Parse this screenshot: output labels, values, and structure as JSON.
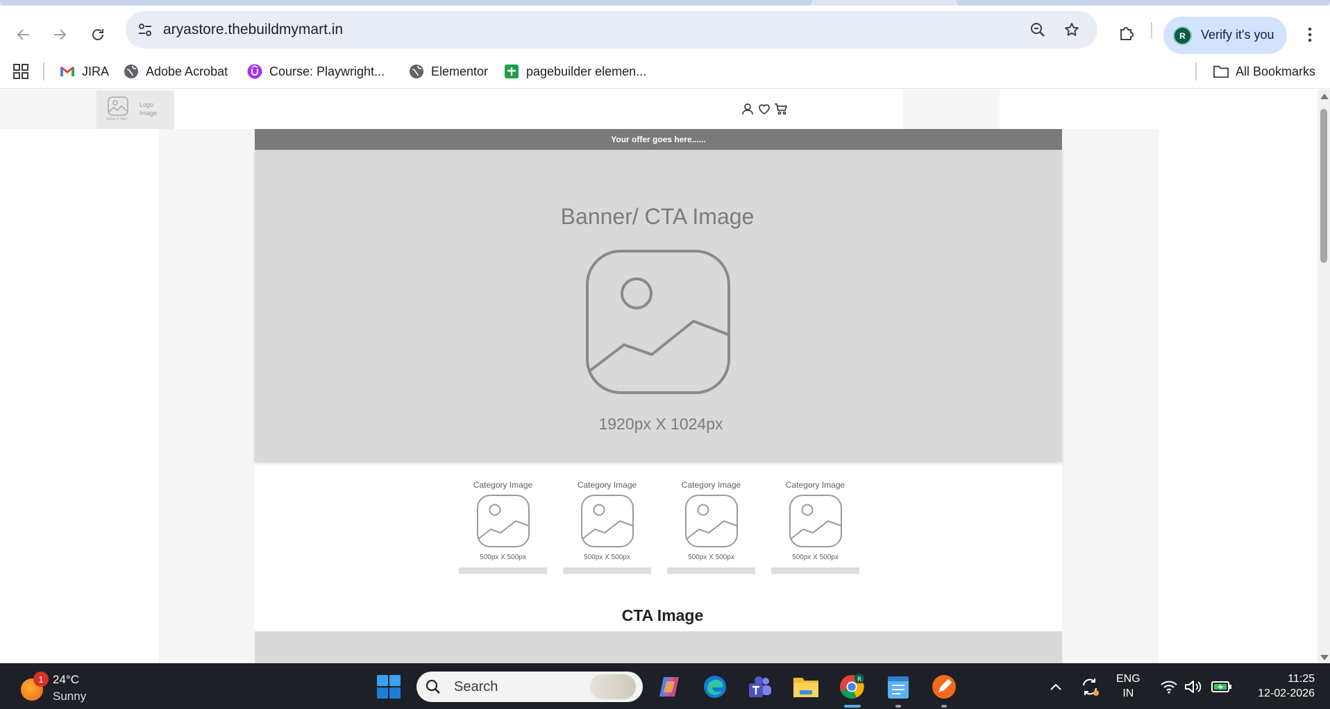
{
  "browser": {
    "url": "aryastore.thebuildmymart.in",
    "profile_label": "Verify it's you",
    "profile_initial": "R"
  },
  "bookmarks": {
    "items": [
      {
        "label": "JIRA",
        "icon": "gmail-icon"
      },
      {
        "label": "Adobe Acrobat",
        "icon": "globe-icon"
      },
      {
        "label": "Course: Playwright...",
        "icon": "udemy-icon"
      },
      {
        "label": "Elementor",
        "icon": "globe-icon"
      },
      {
        "label": "pagebuilder elemen...",
        "icon": "sheets-icon"
      }
    ],
    "all_bookmarks": "All Bookmarks"
  },
  "site": {
    "logo_text_line1": "Logo",
    "logo_text_line2": "Image",
    "logo_size": "150px X 75px",
    "offer_text": "Your offer goes here......",
    "banner_title": "Banner/ CTA Image",
    "banner_size": "1920px X 1024px",
    "categories": [
      {
        "label": "Category Image",
        "size": "500px X 500px"
      },
      {
        "label": "Category Image",
        "size": "500px X 500px"
      },
      {
        "label": "Category Image",
        "size": "500px X 500px"
      },
      {
        "label": "Category Image",
        "size": "500px X 500px"
      }
    ],
    "cta_title": "CTA Image"
  },
  "taskbar": {
    "weather_temp": "24°C",
    "weather_condition": "Sunny",
    "weather_badge": "1",
    "search_label": "Search",
    "lang_line1": "ENG",
    "lang_line2": "IN",
    "time": "11:25",
    "date": "12-02-2026"
  },
  "colors": {
    "omnibox_bg": "#e9eef6",
    "profile_chip_bg": "#d3e3fd",
    "offer_bar": "#7a7a7a",
    "banner_bg": "#d9d9d9",
    "taskbar_bg": "#1d2026"
  }
}
